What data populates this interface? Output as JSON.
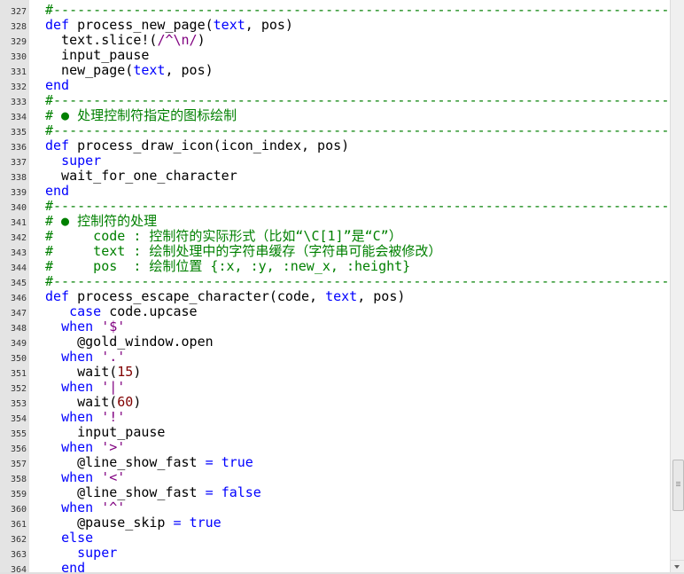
{
  "colors": {
    "keyword": "#0000ff",
    "string": "#800080",
    "number": "#800000",
    "comment": "#008000",
    "text": "#000000",
    "gutter": "#e4e4e4"
  },
  "lines": [
    {
      "n": "327",
      "tokens": [
        {
          "t": "#-----------------------------------------------------------------------------",
          "c": "cm"
        }
      ]
    },
    {
      "n": "328",
      "tokens": [
        {
          "t": "def",
          "c": "kw"
        },
        {
          "t": " process_new_page("
        },
        {
          "t": "text",
          "c": "kw"
        },
        {
          "t": ", pos)"
        }
      ]
    },
    {
      "n": "329",
      "tokens": [
        {
          "t": "  text.slice!("
        },
        {
          "t": "/^\\n/",
          "c": "str"
        },
        {
          "t": ")"
        }
      ]
    },
    {
      "n": "330",
      "tokens": [
        {
          "t": "  input_pause"
        }
      ]
    },
    {
      "n": "331",
      "tokens": [
        {
          "t": "  new_page("
        },
        {
          "t": "text",
          "c": "kw"
        },
        {
          "t": ", pos)"
        }
      ]
    },
    {
      "n": "332",
      "tokens": [
        {
          "t": "end",
          "c": "kw"
        }
      ]
    },
    {
      "n": "333",
      "tokens": [
        {
          "t": "#-----------------------------------------------------------------------------",
          "c": "cm"
        }
      ]
    },
    {
      "n": "334",
      "tokens": [
        {
          "t": "# ● 处理控制符指定的图标绘制",
          "c": "cm"
        }
      ]
    },
    {
      "n": "335",
      "tokens": [
        {
          "t": "#-----------------------------------------------------------------------------",
          "c": "cm"
        }
      ]
    },
    {
      "n": "336",
      "tokens": [
        {
          "t": "def",
          "c": "kw"
        },
        {
          "t": " process_draw_icon(icon_index, pos)"
        }
      ]
    },
    {
      "n": "337",
      "tokens": [
        {
          "t": "  "
        },
        {
          "t": "super",
          "c": "kw"
        }
      ]
    },
    {
      "n": "338",
      "tokens": [
        {
          "t": "  wait_for_one_character"
        }
      ]
    },
    {
      "n": "339",
      "tokens": [
        {
          "t": "end",
          "c": "kw"
        }
      ]
    },
    {
      "n": "340",
      "tokens": [
        {
          "t": "#-----------------------------------------------------------------------------",
          "c": "cm"
        }
      ]
    },
    {
      "n": "341",
      "tokens": [
        {
          "t": "# ● 控制符的处理",
          "c": "cm"
        }
      ]
    },
    {
      "n": "342",
      "tokens": [
        {
          "t": "#     code : 控制符的实际形式（比如“\\C[1]”是“C”）",
          "c": "cm"
        }
      ]
    },
    {
      "n": "343",
      "tokens": [
        {
          "t": "#     text : 绘制处理中的字符串缓存（字符串可能会被修改）",
          "c": "cm"
        }
      ]
    },
    {
      "n": "344",
      "tokens": [
        {
          "t": "#     pos  : 绘制位置 {:x, :y, :new_x, :height}",
          "c": "cm"
        }
      ]
    },
    {
      "n": "345",
      "tokens": [
        {
          "t": "#-----------------------------------------------------------------------------",
          "c": "cm"
        }
      ]
    },
    {
      "n": "346",
      "tokens": [
        {
          "t": "def",
          "c": "kw"
        },
        {
          "t": " process_escape_character(code, "
        },
        {
          "t": "text",
          "c": "kw"
        },
        {
          "t": ", pos)"
        }
      ]
    },
    {
      "n": "347",
      "tokens": [
        {
          "t": "   "
        },
        {
          "t": "case",
          "c": "kw"
        },
        {
          "t": " code.upcase"
        }
      ]
    },
    {
      "n": "348",
      "tokens": [
        {
          "t": "  "
        },
        {
          "t": "when",
          "c": "kw"
        },
        {
          "t": " "
        },
        {
          "t": "'$'",
          "c": "str"
        }
      ]
    },
    {
      "n": "349",
      "tokens": [
        {
          "t": "    @gold_window.open"
        }
      ]
    },
    {
      "n": "350",
      "tokens": [
        {
          "t": "  "
        },
        {
          "t": "when",
          "c": "kw"
        },
        {
          "t": " "
        },
        {
          "t": "'.'",
          "c": "str"
        }
      ]
    },
    {
      "n": "351",
      "tokens": [
        {
          "t": "    wait("
        },
        {
          "t": "15",
          "c": "num"
        },
        {
          "t": ")"
        }
      ]
    },
    {
      "n": "352",
      "tokens": [
        {
          "t": "  "
        },
        {
          "t": "when",
          "c": "kw"
        },
        {
          "t": " "
        },
        {
          "t": "'|'",
          "c": "str"
        }
      ]
    },
    {
      "n": "353",
      "tokens": [
        {
          "t": "    wait("
        },
        {
          "t": "60",
          "c": "num"
        },
        {
          "t": ")"
        }
      ]
    },
    {
      "n": "354",
      "tokens": [
        {
          "t": "  "
        },
        {
          "t": "when",
          "c": "kw"
        },
        {
          "t": " "
        },
        {
          "t": "'!'",
          "c": "str"
        }
      ]
    },
    {
      "n": "355",
      "tokens": [
        {
          "t": "    input_pause"
        }
      ]
    },
    {
      "n": "356",
      "tokens": [
        {
          "t": "  "
        },
        {
          "t": "when",
          "c": "kw"
        },
        {
          "t": " "
        },
        {
          "t": "'>'",
          "c": "str"
        }
      ]
    },
    {
      "n": "357",
      "tokens": [
        {
          "t": "    @line_show_fast "
        },
        {
          "t": "=",
          "c": "kw"
        },
        {
          "t": " "
        },
        {
          "t": "true",
          "c": "kw"
        }
      ]
    },
    {
      "n": "358",
      "tokens": [
        {
          "t": "  "
        },
        {
          "t": "when",
          "c": "kw"
        },
        {
          "t": " "
        },
        {
          "t": "'<'",
          "c": "str"
        }
      ]
    },
    {
      "n": "359",
      "tokens": [
        {
          "t": "    @line_show_fast "
        },
        {
          "t": "=",
          "c": "kw"
        },
        {
          "t": " "
        },
        {
          "t": "false",
          "c": "kw"
        }
      ]
    },
    {
      "n": "360",
      "tokens": [
        {
          "t": "  "
        },
        {
          "t": "when",
          "c": "kw"
        },
        {
          "t": " "
        },
        {
          "t": "'^'",
          "c": "str"
        }
      ]
    },
    {
      "n": "361",
      "tokens": [
        {
          "t": "    @pause_skip "
        },
        {
          "t": "=",
          "c": "kw"
        },
        {
          "t": " "
        },
        {
          "t": "true",
          "c": "kw"
        }
      ]
    },
    {
      "n": "362",
      "tokens": [
        {
          "t": "  "
        },
        {
          "t": "else",
          "c": "kw"
        }
      ]
    },
    {
      "n": "363",
      "tokens": [
        {
          "t": "    "
        },
        {
          "t": "super",
          "c": "kw"
        }
      ]
    },
    {
      "n": "364",
      "tokens": [
        {
          "t": "  "
        },
        {
          "t": "end",
          "c": "kw"
        }
      ]
    }
  ]
}
